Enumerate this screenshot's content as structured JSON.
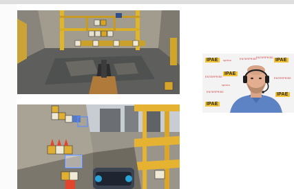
{
  "background_logos": {
    "brand_a": "IPAE",
    "brand_b": "spreco",
    "brand_c": "ENTERPRISE"
  }
}
